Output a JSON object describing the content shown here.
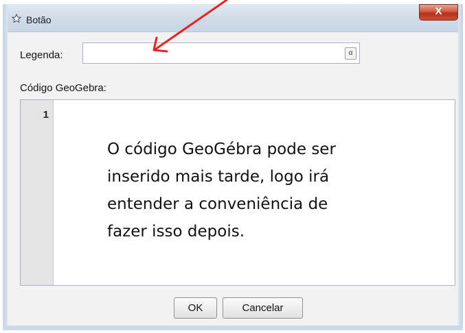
{
  "window": {
    "title": "Botão",
    "close_label": "X",
    "icon": "star-outline-icon"
  },
  "form": {
    "legend_label": "Legenda:",
    "legend_value": "",
    "alpha_symbol": "α",
    "code_label": "Código GeoGebra:",
    "code_lines": [
      "1"
    ]
  },
  "annotation": {
    "lines": [
      "O código GeoGébra pode ser",
      "inserido mais tarde, logo irá",
      "entender a conveniência de",
      "fazer isso depois."
    ],
    "arrow_color": "#e8231f"
  },
  "buttons": {
    "ok_label": "OK",
    "cancel_label": "Cancelar"
  }
}
